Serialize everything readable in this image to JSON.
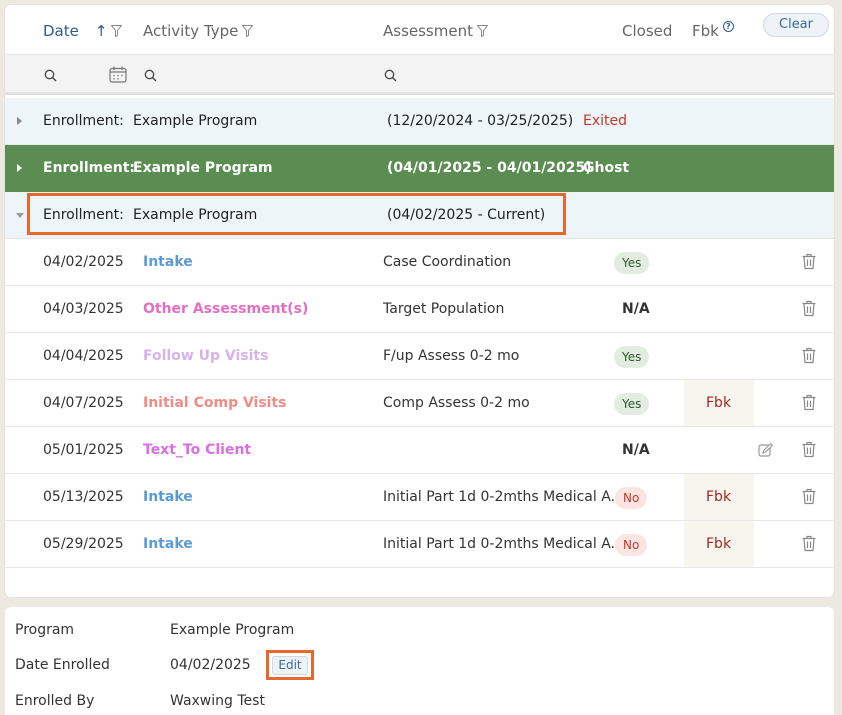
{
  "columns": {
    "date": "Date",
    "activity_type": "Activity Type",
    "assessment": "Assessment",
    "closed": "Closed",
    "fbk": "Fbk",
    "clear": "Clear"
  },
  "enrollments": [
    {
      "label": "Enrollment:",
      "program": "Example Program",
      "range": "(12/20/2024 - 03/25/2025)",
      "status": "Exited"
    },
    {
      "label": "Enrollment:",
      "program": "Example Program",
      "range": "(04/01/2025 - 04/01/2025)",
      "status": "Ghost"
    },
    {
      "label": "Enrollment:",
      "program": "Example Program",
      "range": "(04/02/2025 - Current)",
      "status": ""
    }
  ],
  "activities": [
    {
      "date": "04/02/2025",
      "type": "Intake",
      "type_color": "#5b9bd5",
      "assessment": "Case Coordination",
      "closed": "Yes",
      "fbk": ""
    },
    {
      "date": "04/03/2025",
      "type": "Other Assessment(s)",
      "type_color": "#e46fc2",
      "assessment": "Target Population",
      "closed": "N/A",
      "fbk": ""
    },
    {
      "date": "04/04/2025",
      "type": "Follow Up Visits",
      "type_color": "#d7b2ea",
      "assessment": "F/up Assess 0-2 mo",
      "closed": "Yes",
      "fbk": ""
    },
    {
      "date": "04/07/2025",
      "type": "Initial Comp Visits",
      "type_color": "#f08c84",
      "assessment": "Comp Assess 0-2 mo",
      "closed": "Yes",
      "fbk": "Fbk"
    },
    {
      "date": "05/01/2025",
      "type": "Text_To Client",
      "type_color": "#d86ee6",
      "assessment": "",
      "closed": "N/A",
      "fbk": ""
    },
    {
      "date": "05/13/2025",
      "type": "Intake",
      "type_color": "#5b9bd5",
      "assessment": "Initial Part 1d 0-2mths Medical A...",
      "closed": "No",
      "fbk": "Fbk"
    },
    {
      "date": "05/29/2025",
      "type": "Intake",
      "type_color": "#5b9bd5",
      "assessment": "Initial Part 1d 0-2mths Medical A...",
      "closed": "No",
      "fbk": "Fbk"
    }
  ],
  "details": {
    "program_label": "Program",
    "program_value": "Example Program",
    "date_enrolled_label": "Date Enrolled",
    "date_enrolled_value": "04/02/2025",
    "edit_label": "Edit",
    "enrolled_by_label": "Enrolled By",
    "enrolled_by_value": "Waxwing Test"
  },
  "colors": {
    "ghost_row": "#5b8c51",
    "highlight": "#e8672a",
    "exited": "#c0392b"
  }
}
